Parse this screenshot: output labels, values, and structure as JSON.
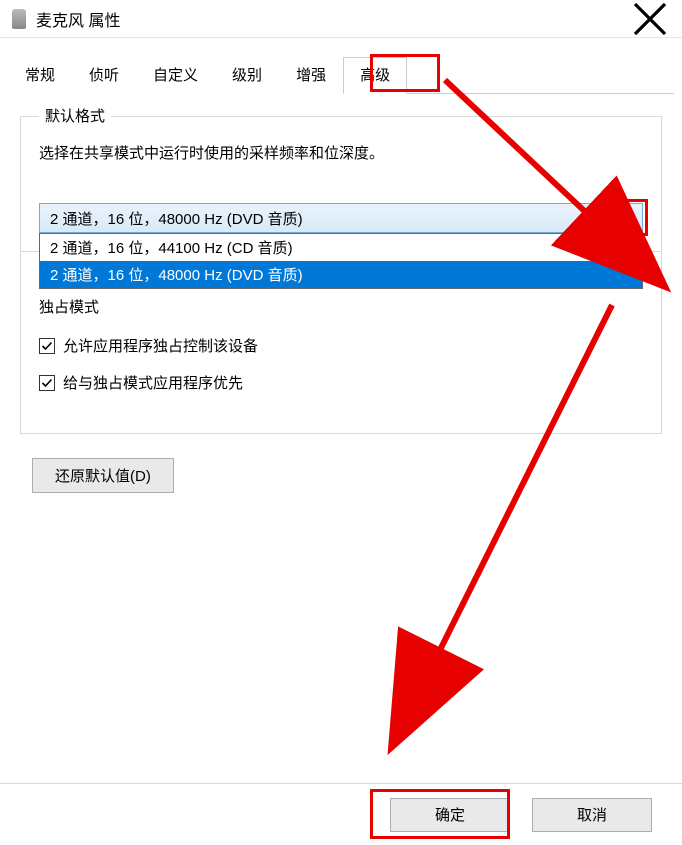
{
  "window": {
    "title": "麦克风 属性"
  },
  "tabs": [
    {
      "label": "常规"
    },
    {
      "label": "侦听"
    },
    {
      "label": "自定义"
    },
    {
      "label": "级别"
    },
    {
      "label": "增强"
    },
    {
      "label": "高级"
    }
  ],
  "defaultFormat": {
    "groupTitle": "默认格式",
    "description": "选择在共享模式中运行时使用的采样频率和位深度。",
    "selected": "2 通道，16 位，48000 Hz (DVD 音质)",
    "options": [
      "2 通道，16 位，44100 Hz (CD 音质)",
      "2 通道，16 位，48000 Hz (DVD 音质)"
    ]
  },
  "exclusive": {
    "groupTitle": "独占模式",
    "checkbox1": "允许应用程序独占控制该设备",
    "checkbox2": "给与独占模式应用程序优先"
  },
  "restoreBtn": "还原默认值(D)",
  "footer": {
    "ok": "确定",
    "cancel": "取消"
  }
}
